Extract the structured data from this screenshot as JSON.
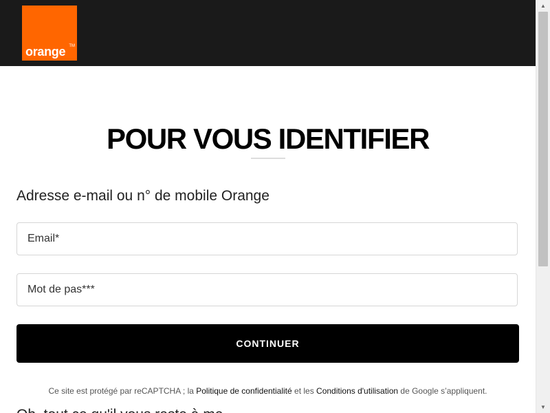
{
  "header": {
    "logo": {
      "text": "orange",
      "trademark": "TM",
      "color": "#ff6600"
    },
    "background": "#1a1a1a"
  },
  "main": {
    "title": "POUR VOUS IDENTIFIER",
    "subtitle": "Adresse e-mail ou n° de mobile Orange",
    "fields": {
      "email": {
        "value": "",
        "placeholder": "Email*"
      },
      "password": {
        "value": "",
        "placeholder": "Mot de pas***"
      }
    },
    "submit_label": "CONTINUER",
    "legal": {
      "prefix": "Ce site est protégé par reCAPTCHA ; la ",
      "privacy_link": "Politique de confidentialité",
      "middle": " et les ",
      "terms_link": "Conditions d'utilisation",
      "suffix": " de Google s’appliquent."
    },
    "cut_off_text": "Oh, tout ce qu'il vous reste à me..."
  },
  "scrollbar": {
    "up_icon": "chevron-up-icon",
    "down_icon": "chevron-down-icon"
  }
}
